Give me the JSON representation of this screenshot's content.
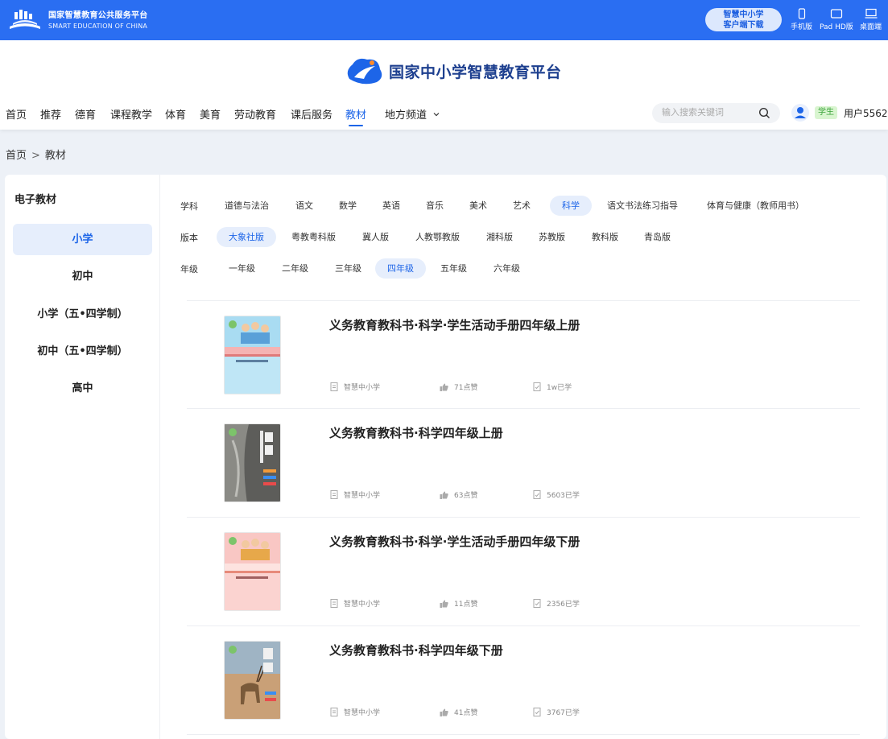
{
  "topbar": {
    "brand_cn": "国家智慧教育公共服务平台",
    "brand_en": "SMART EDUCATION OF CHINA",
    "download_line1": "智慧中小学",
    "download_line2": "客户端下载",
    "devices": [
      "手机版",
      "Pad HD版",
      "桌面端"
    ]
  },
  "header": {
    "site_title": "国家中小学智慧教育平台",
    "nav": [
      "首页",
      "推荐",
      "德育",
      "课程教学",
      "体育",
      "美育",
      "劳动教育",
      "课后服务",
      "教材",
      "地方频道"
    ],
    "nav_active": "教材",
    "search_placeholder": "输入搜索关键词",
    "role": "学生",
    "username": "用户5562"
  },
  "breadcrumb": [
    "首页",
    "教材"
  ],
  "sidebar": {
    "title": "电子教材",
    "items": [
      "小学",
      "初中",
      "小学（五•四学制）",
      "初中（五•四学制）",
      "高中"
    ],
    "active": "小学"
  },
  "filters": {
    "subject": {
      "label": "学科",
      "options": [
        "道德与法治",
        "语文",
        "数学",
        "英语",
        "音乐",
        "美术",
        "艺术",
        "科学",
        "语文书法练习指导",
        "体育与健康（教师用书）"
      ],
      "active": "科学"
    },
    "edition": {
      "label": "版本",
      "options": [
        "大象社版",
        "粤教粤科版",
        "冀人版",
        "人教鄂教版",
        "湘科版",
        "苏教版",
        "教科版",
        "青岛版"
      ],
      "active": "大象社版"
    },
    "grade": {
      "label": "年级",
      "options": [
        "一年级",
        "二年级",
        "三年级",
        "四年级",
        "五年级",
        "六年级"
      ],
      "active": "四年级"
    }
  },
  "books": [
    {
      "title": "义务教育教科书·科学·学生活动手册四年级上册",
      "publisher": "智慧中小学",
      "likes": "71点赞",
      "learned": "1w已学",
      "cover": "blue"
    },
    {
      "title": "义务教育教科书·科学四年级上册",
      "publisher": "智慧中小学",
      "likes": "63点赞",
      "learned": "5603已学",
      "cover": "rock"
    },
    {
      "title": "义务教育教科书·科学·学生活动手册四年级下册",
      "publisher": "智慧中小学",
      "likes": "11点赞",
      "learned": "2356已学",
      "cover": "pink"
    },
    {
      "title": "义务教育教科书·科学四年级下册",
      "publisher": "智慧中小学",
      "likes": "41点赞",
      "learned": "3767已学",
      "cover": "antelope"
    }
  ],
  "colors": {
    "primary": "#2a6ef2",
    "accent": "#1d65e8",
    "active_bg": "#e6eefc"
  }
}
